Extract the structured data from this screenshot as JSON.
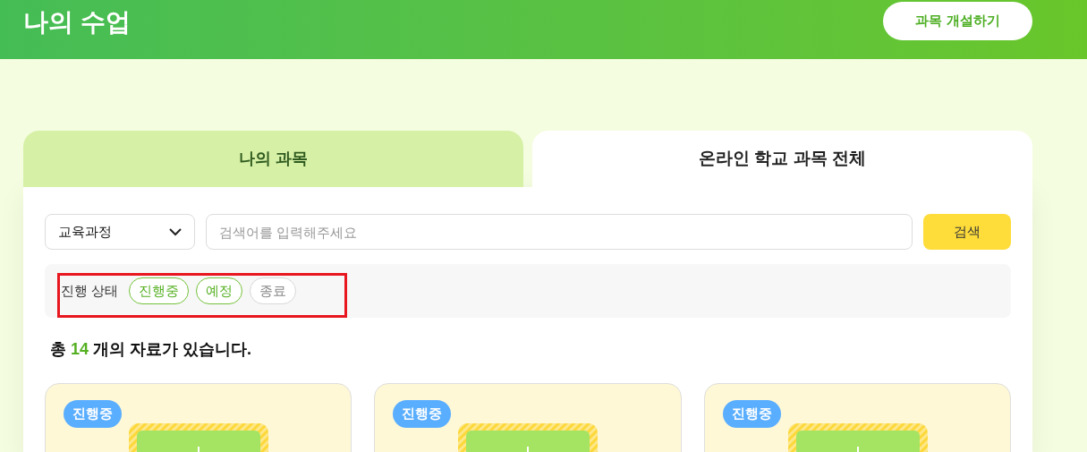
{
  "header": {
    "title": "나의 수업",
    "create_button": "과목 개설하기"
  },
  "tabs": [
    {
      "label": "나의 과목",
      "selected": false
    },
    {
      "label": "온라인 학교 과목 전체",
      "selected": true
    }
  ],
  "filters": {
    "curriculum_select": "교육과정",
    "search": {
      "placeholder": "검색어를 입력해주세요"
    },
    "search_button": "검색"
  },
  "status_filter": {
    "label": "진행 상태",
    "chips": [
      {
        "label": "진행중",
        "selected": true
      },
      {
        "label": "예정",
        "selected": true
      },
      {
        "label": "종료",
        "selected": false
      }
    ]
  },
  "result": {
    "prefix": "총",
    "count": "14",
    "suffix": "개의 자료가 있습니다."
  },
  "cards": [
    {
      "badge": "진행중"
    },
    {
      "badge": "진행중"
    },
    {
      "badge": "진행중"
    }
  ]
}
